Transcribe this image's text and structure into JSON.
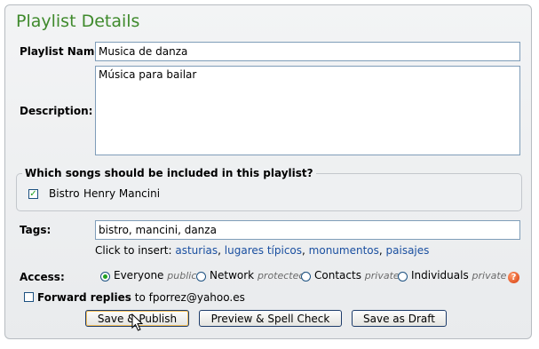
{
  "title": "Playlist Details",
  "name_field": {
    "label": "Playlist Name:",
    "value": "Musica de danza"
  },
  "description_field": {
    "label": "Description:",
    "value": "Música para bailar"
  },
  "songs": {
    "legend": "Which songs should be included in this playlist?",
    "items": [
      {
        "title": "Bistro",
        "artist": "Henry Mancini",
        "checked": true
      }
    ]
  },
  "tags": {
    "label": "Tags:",
    "value": "bistro, mancini, danza",
    "insert_prefix": "Click to insert:",
    "suggestions": [
      "asturias",
      "lugares típicos",
      "monumentos",
      "paisajes"
    ]
  },
  "access": {
    "label": "Access:",
    "selected": "Everyone",
    "options": [
      {
        "label": "Everyone",
        "note": "public"
      },
      {
        "label": "Network",
        "note": "protected"
      },
      {
        "label": "Contacts",
        "note": "private"
      },
      {
        "label": "Individuals",
        "note": "private"
      }
    ]
  },
  "forward": {
    "label": "Forward replies",
    "email": "to fporrez@yahoo.es",
    "checked": false
  },
  "buttons": {
    "publish": "Save & Publish",
    "preview": "Preview & Spell Check",
    "draft": "Save as Draft"
  },
  "colors": {
    "title": "#3f8a2c",
    "link": "#1a4fa0",
    "check": "#21a121",
    "help": "#d63b0c"
  },
  "icons": {
    "help": "help-icon",
    "cursor": "mouse-pointer-icon",
    "check": "checkmark-icon"
  }
}
